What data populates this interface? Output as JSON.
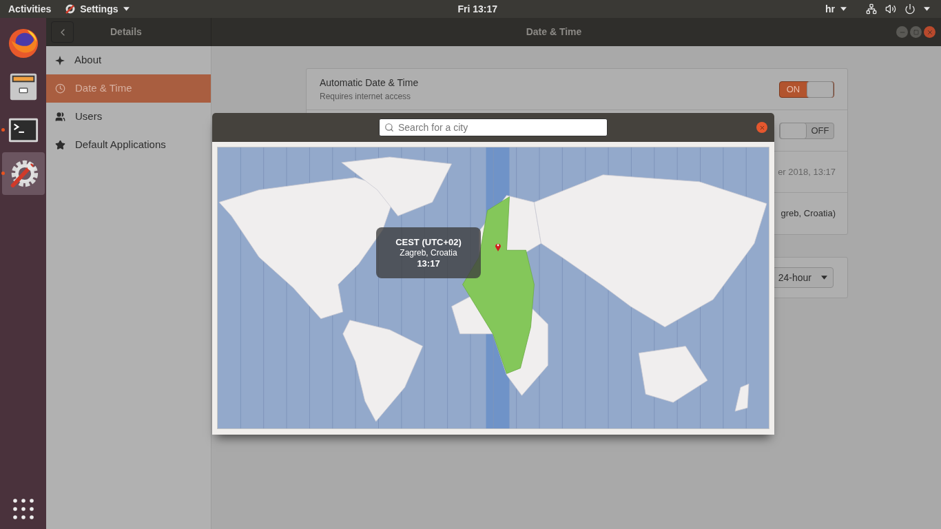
{
  "top_bar": {
    "activities": "Activities",
    "app_menu": "Settings",
    "clock": "Fri 13:17",
    "keyboard_layout": "hr"
  },
  "dock": [
    {
      "kind": "firefox",
      "running": false,
      "selected": false
    },
    {
      "kind": "files",
      "running": false,
      "selected": false
    },
    {
      "kind": "terminal",
      "running": true,
      "selected": false
    },
    {
      "kind": "settings",
      "running": true,
      "selected": true
    }
  ],
  "header": {
    "sidebar_title": "Details",
    "title": "Date & Time"
  },
  "sidebar": {
    "items": [
      {
        "kind": "about",
        "label": "About",
        "selected": false
      },
      {
        "kind": "clock",
        "label": "Date & Time",
        "selected": true
      },
      {
        "kind": "users",
        "label": "Users",
        "selected": false
      },
      {
        "kind": "star",
        "label": "Default Applications",
        "selected": false
      }
    ]
  },
  "settings": {
    "rows": [
      {
        "kind": "switch",
        "title": "Automatic Date & Time",
        "subtitle": "Requires internet access",
        "on": true,
        "label": "ON"
      },
      {
        "kind": "switch",
        "on": false,
        "label": "OFF"
      },
      {
        "kind": "value",
        "value": "er 2018, 13:17",
        "muted": true
      },
      {
        "kind": "value",
        "value": "greb, Croatia)",
        "muted": false
      }
    ],
    "time_format": {
      "value": "24-hour"
    }
  },
  "dialog": {
    "search_placeholder": "Search for a city",
    "tooltip": {
      "zone": "CEST (UTC+02)",
      "city": "Zagreb, Croatia",
      "time": "13:17"
    }
  }
}
